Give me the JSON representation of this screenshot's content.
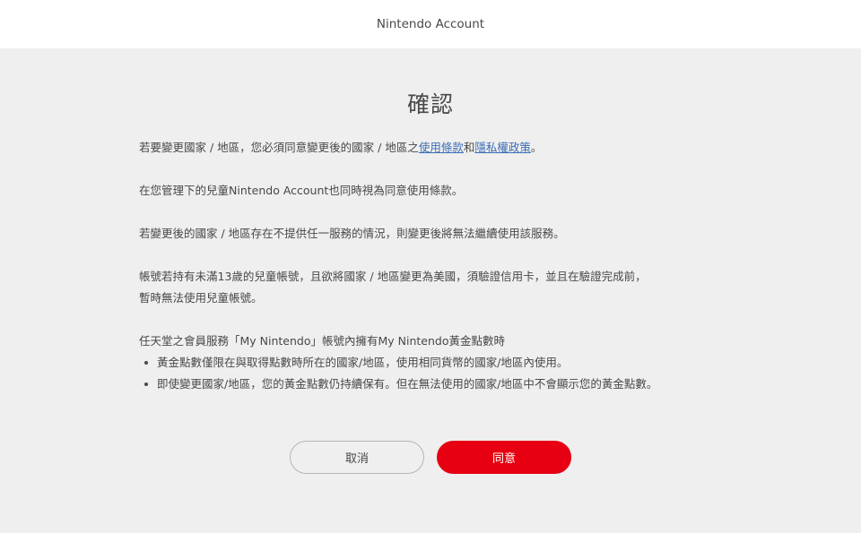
{
  "header": {
    "title": "Nintendo Account"
  },
  "dialog": {
    "title": "確認",
    "para1": {
      "before": "若要變更國家 / 地區，您必須同意變更後的國家 / 地區之",
      "terms_link": "使用條款",
      "and": "和",
      "privacy_link": "隱私權政策",
      "after": "。"
    },
    "para2": "在您管理下的兒童Nintendo Account也同時視為同意使用條款。",
    "para3": "若變更後的國家 / 地區存在不提供任一服務的情況，則變更後將無法繼續使用該服務。",
    "para4": {
      "line1": "帳號若持有未滿13歲的兒童帳號，且欲將國家 / 地區變更為美國，須驗證信用卡，並且在驗證完成前，",
      "line2": "暫時無法使用兒童帳號。"
    },
    "para5": {
      "intro": "任天堂之會員服務「My Nintendo」帳號內擁有My Nintendo黃金點數時",
      "bullets": [
        "黃金點數僅限在與取得點數時所在的國家/地區，使用相同貨幣的國家/地區內使用。",
        "即使變更國家/地區，您的黃金點數仍持續保有。但在無法使用的國家/地區中不會顯示您的黃金點數。"
      ]
    }
  },
  "buttons": {
    "cancel_label": "取消",
    "agree_label": "同意"
  },
  "colors": {
    "accent": "#e60012",
    "link": "#3c6db5",
    "background": "#efefef"
  }
}
